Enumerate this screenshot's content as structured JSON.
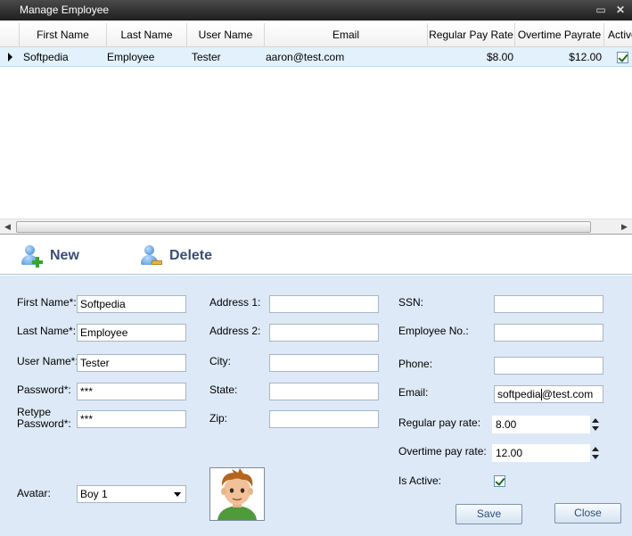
{
  "window": {
    "title": "Manage Employee",
    "max_glyph": "▭",
    "close_glyph": "✕"
  },
  "grid": {
    "columns": [
      "First Name",
      "Last Name",
      "User Name",
      "Email",
      "Regular Pay Rate",
      "Overtime Payrate",
      "Active"
    ],
    "rows": [
      {
        "first_name": "Softpedia",
        "last_name": "Employee",
        "user_name": "Tester",
        "email": "aaron@test.com",
        "regular_pay": "$8.00",
        "overtime_pay": "$12.00",
        "active": true
      }
    ],
    "scroll_left": "◀",
    "scroll_right": "▶"
  },
  "toolbar": {
    "new_label": "New",
    "delete_label": "Delete"
  },
  "form": {
    "labels": {
      "first_name": "First Name*:",
      "last_name": "Last Name*:",
      "user_name": "User Name*:",
      "password": "Password*:",
      "retype_password_1": "Retype",
      "retype_password_2": "Password*:",
      "avatar": "Avatar:",
      "address1": "Address 1:",
      "address2": "Address 2:",
      "city": "City:",
      "state": "State:",
      "zip": "Zip:",
      "ssn": "SSN:",
      "employee_no": "Employee No.:",
      "phone": "Phone:",
      "email": "Email:",
      "regular_pay": "Regular pay rate:",
      "overtime_pay": "Overtime pay rate:",
      "is_active": "Is Active:"
    },
    "values": {
      "first_name": "Softpedia",
      "last_name": "Employee",
      "user_name": "Tester",
      "password": "***",
      "retype_password": "***",
      "avatar": "Boy 1",
      "address1": "",
      "address2": "",
      "city": "",
      "state": "",
      "zip": "",
      "ssn": "",
      "employee_no": "",
      "phone": "",
      "email_before_caret": "softpedia",
      "email_after_caret": "@test.com",
      "regular_pay": "8.00",
      "overtime_pay": "12.00",
      "is_active": true
    },
    "save_label": "Save",
    "close_label": "Close"
  }
}
